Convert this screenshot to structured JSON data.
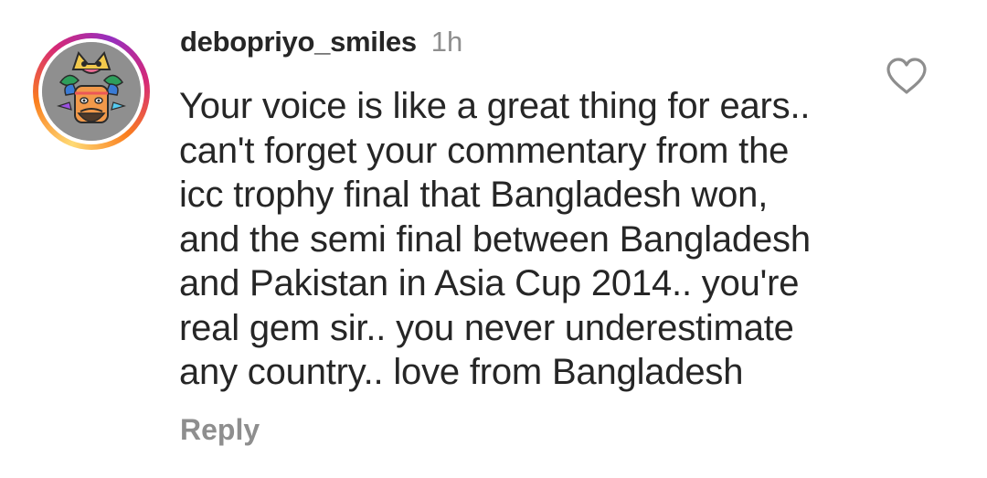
{
  "comment": {
    "username": "debopriyo_smiles",
    "time": "1h",
    "text": "Your voice is like a great thing for ears..\ncan't forget your commentary from the\nicc trophy final that Bangladesh won,\nand the semi final between Bangladesh\nand Pakistan in Asia Cup 2014.. you're\nreal gem sir.. you never underestimate\nany country.. love from Bangladesh",
    "reply_label": "Reply",
    "avatar_icon": "cartoon-illustration-avatar",
    "like_icon": "heart-outline-icon"
  },
  "colors": {
    "text_primary": "#262626",
    "text_secondary": "#8e8e8e",
    "story_ring_start": "#feda75",
    "story_ring_mid": "#d62976",
    "story_ring_end": "#962fbf"
  }
}
